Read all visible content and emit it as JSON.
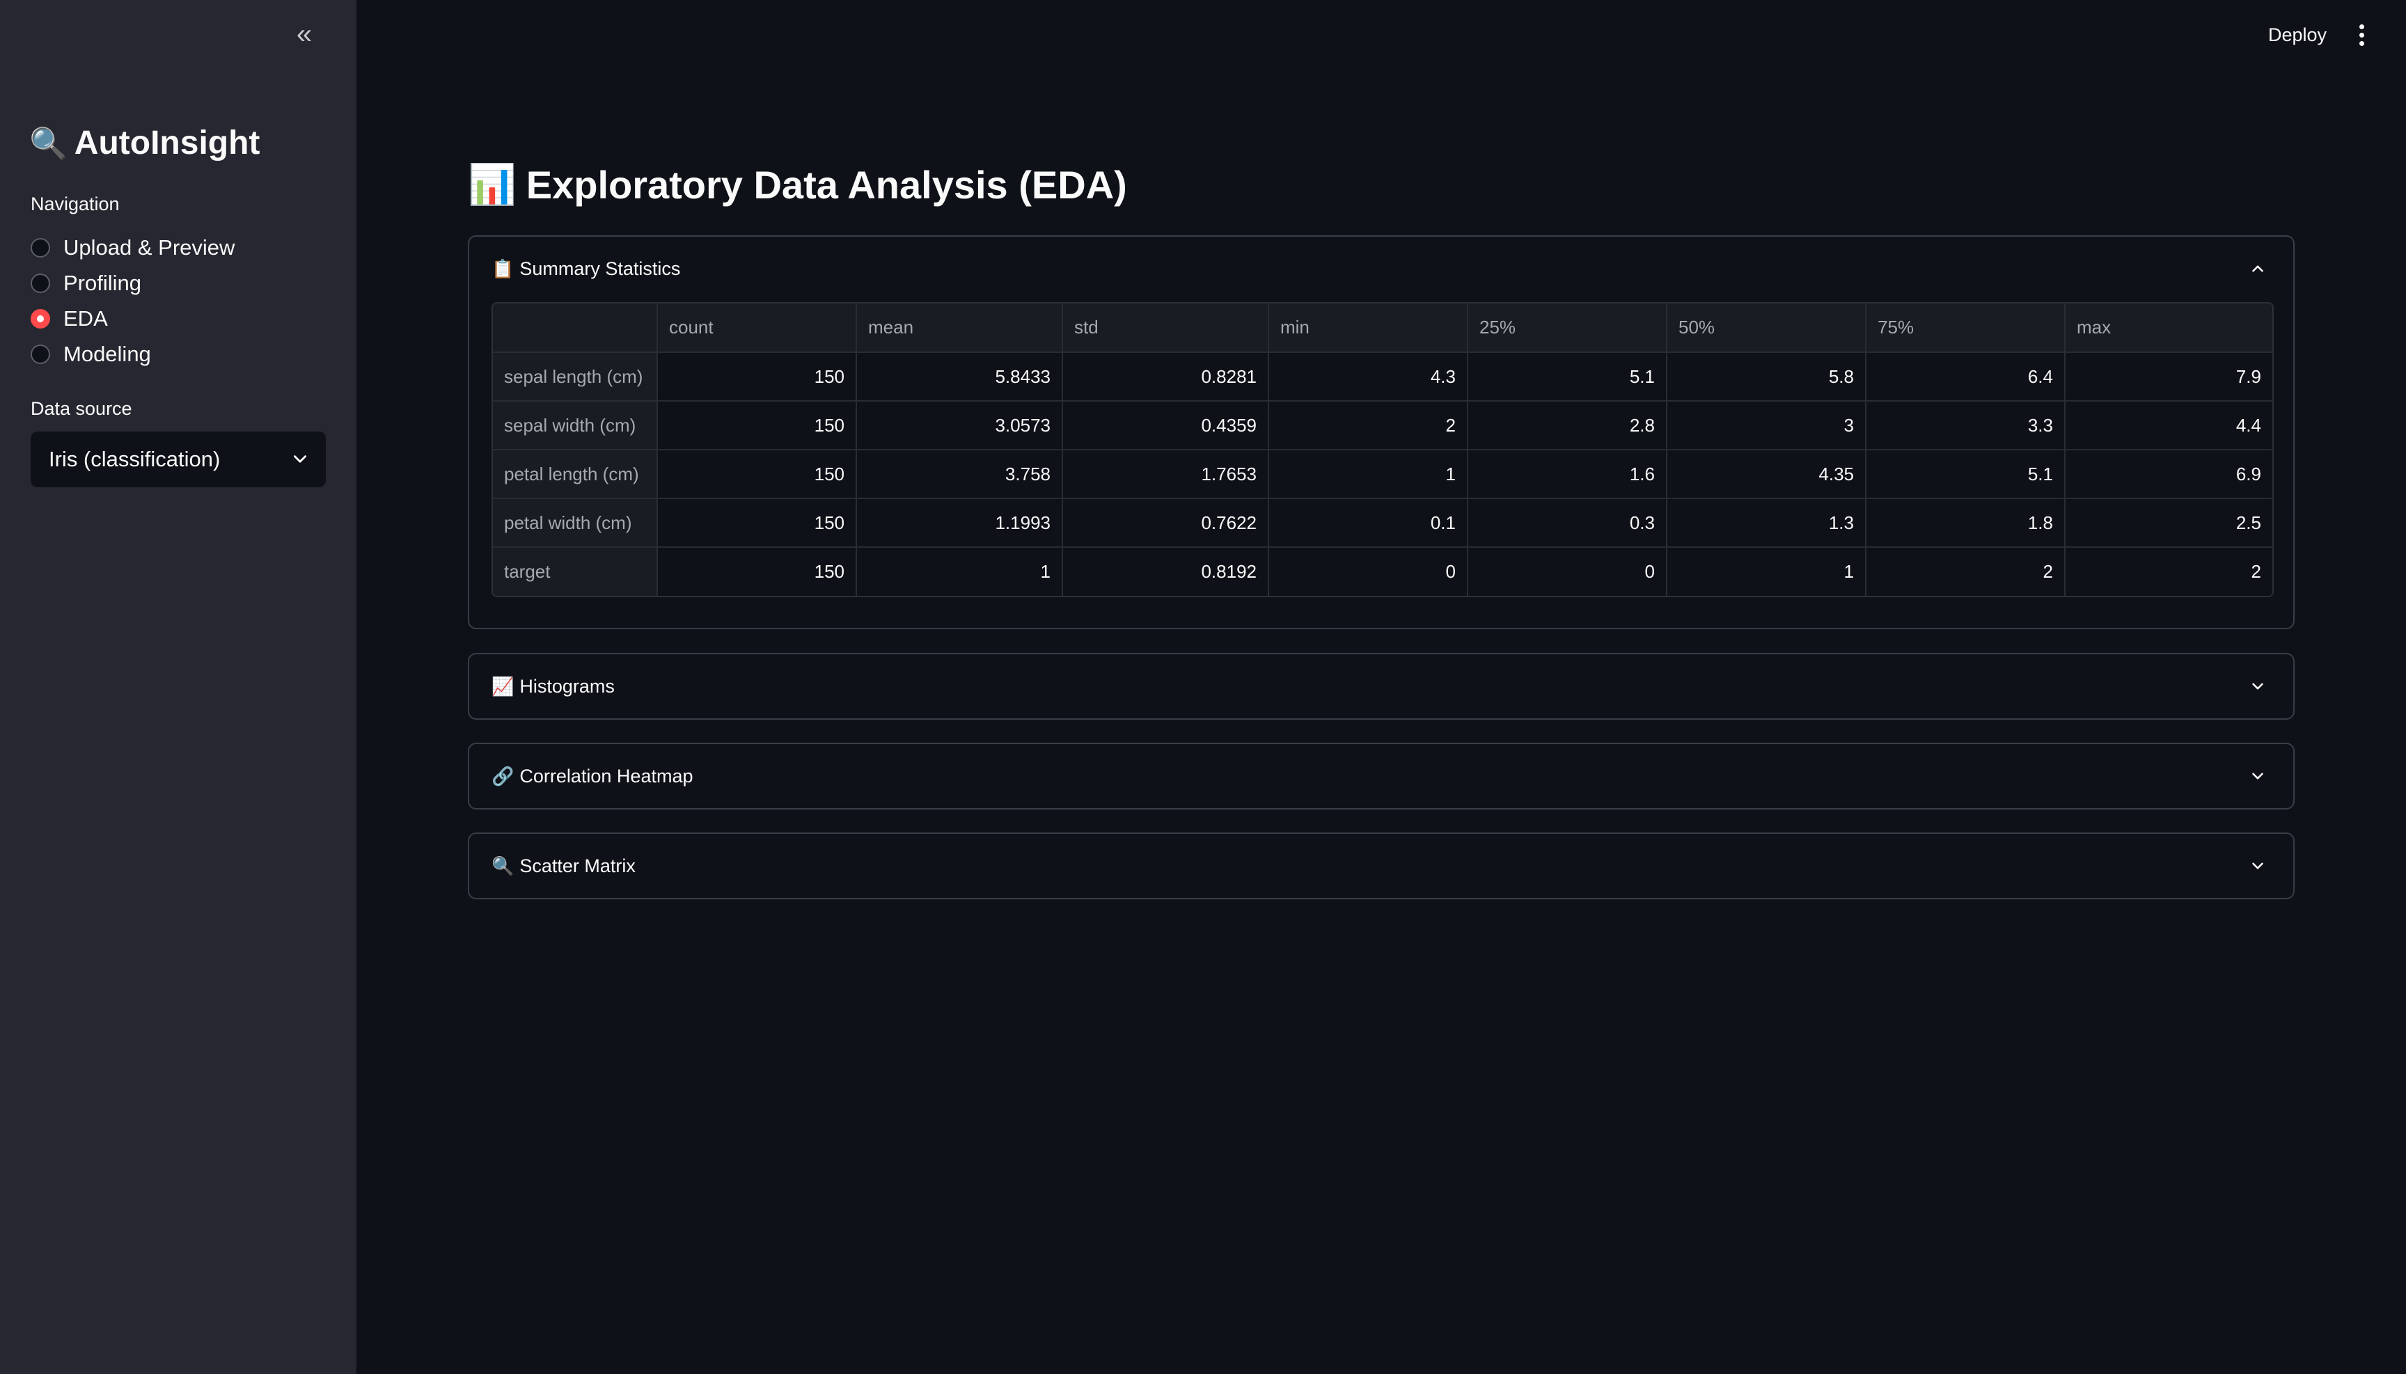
{
  "sidebar": {
    "collapse_icon": "double-chevron-left-icon",
    "app_title": "AutoInsight",
    "app_icon": "🔍",
    "navigation_label": "Navigation",
    "nav_items": [
      {
        "label": "Upload & Preview",
        "checked": false
      },
      {
        "label": "Profiling",
        "checked": false
      },
      {
        "label": "EDA",
        "checked": true
      },
      {
        "label": "Modeling",
        "checked": false
      }
    ],
    "data_source_label": "Data source",
    "data_source_value": "Iris (classification)"
  },
  "header": {
    "deploy_label": "Deploy",
    "menu_icon": "kebab-menu-icon"
  },
  "main": {
    "title_icon": "📊",
    "title": "Exploratory Data Analysis (EDA)",
    "expanders": [
      {
        "icon": "📋",
        "label": "Summary Statistics",
        "expanded": true
      },
      {
        "icon": "📈",
        "label": "Histograms",
        "expanded": false
      },
      {
        "icon": "🔗",
        "label": "Correlation Heatmap",
        "expanded": false
      },
      {
        "icon": "🔍",
        "label": "Scatter Matrix",
        "expanded": false
      }
    ],
    "summary_table": {
      "columns": [
        "",
        "count",
        "mean",
        "std",
        "min",
        "25%",
        "50%",
        "75%",
        "max"
      ],
      "rows": [
        [
          "sepal length (cm)",
          "150",
          "5.8433",
          "0.8281",
          "4.3",
          "5.1",
          "5.8",
          "6.4",
          "7.9"
        ],
        [
          "sepal width (cm)",
          "150",
          "3.0573",
          "0.4359",
          "2",
          "2.8",
          "3",
          "3.3",
          "4.4"
        ],
        [
          "petal length (cm)",
          "150",
          "3.758",
          "1.7653",
          "1",
          "1.6",
          "4.35",
          "5.1",
          "6.9"
        ],
        [
          "petal width (cm)",
          "150",
          "1.1993",
          "0.7622",
          "0.1",
          "0.3",
          "1.3",
          "1.8",
          "2.5"
        ],
        [
          "target",
          "150",
          "1",
          "0.8192",
          "0",
          "0",
          "1",
          "2",
          "2"
        ]
      ]
    }
  },
  "colors": {
    "background": "#0e1117",
    "sidebar": "#262730",
    "accent": "#ff4b4b",
    "border": "#3a3d48"
  }
}
